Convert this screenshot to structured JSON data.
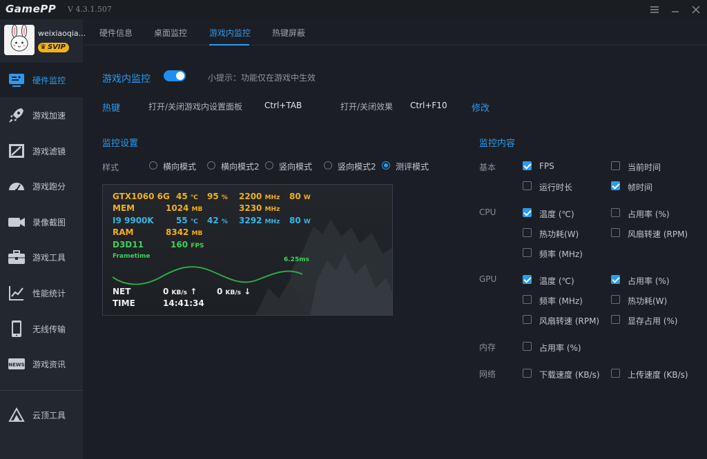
{
  "app": {
    "logo": "GamePP",
    "version": "V 4.3.1.507"
  },
  "user": {
    "name": "weixiaoqia...",
    "badge": "SVIP",
    "badge_crown": "♛"
  },
  "sidebar": {
    "items": [
      {
        "label": "硬件监控",
        "icon": "hardware-monitor-icon",
        "active": true
      },
      {
        "label": "游戏加速",
        "icon": "rocket-icon"
      },
      {
        "label": "游戏滤镜",
        "icon": "filter-icon"
      },
      {
        "label": "游戏跑分",
        "icon": "speedometer-icon"
      },
      {
        "label": "录像截图",
        "icon": "camera-icon"
      },
      {
        "label": "游戏工具",
        "icon": "toolbox-icon"
      },
      {
        "label": "性能统计",
        "icon": "chart-icon"
      },
      {
        "label": "无线传输",
        "icon": "tablet-icon"
      },
      {
        "label": "游戏资讯",
        "icon": "news-icon"
      }
    ],
    "cloud": {
      "label": "云顶工具",
      "icon": "cloud-tool-icon"
    }
  },
  "tabs": [
    {
      "label": "硬件信息"
    },
    {
      "label": "桌面监控"
    },
    {
      "label": "游戏内监控",
      "active": true
    },
    {
      "label": "热键屏蔽"
    }
  ],
  "main": {
    "title": "游戏内监控",
    "toggle_on": true,
    "hint": "小提示：功能仅在游戏中生效",
    "hotkey": {
      "label": "热键",
      "settings_label": "打开/关闭游戏内设置面板",
      "settings_key": "Ctrl+TAB",
      "effect_label": "打开/关闭效果",
      "effect_key": "Ctrl+F10",
      "modify": "修改"
    },
    "settings_title": "监控设置",
    "style_label": "样式",
    "styles": [
      {
        "label": "横向模式",
        "selected": false
      },
      {
        "label": "横向模式2",
        "selected": false
      },
      {
        "label": "竖向模式",
        "selected": false
      },
      {
        "label": "竖向模式2",
        "selected": false
      },
      {
        "label": "测评模式",
        "selected": true
      }
    ],
    "preview": {
      "gpu": {
        "name": "GTX1060 6G",
        "temp": "45",
        "temp_unit": "℃",
        "usage": "95",
        "usage_unit": "%",
        "clock": "2200",
        "clock_unit": "MHz",
        "power": "80",
        "power_unit": "W"
      },
      "mem": {
        "name": "MEM",
        "value": "1024",
        "value_unit": "MB",
        "clock": "3230",
        "clock_unit": "MHz"
      },
      "cpu": {
        "name": "I9 9900K",
        "temp": "55",
        "temp_unit": "℃",
        "usage": "42",
        "usage_unit": "%",
        "clock": "3292",
        "clock_unit": "MHz",
        "power": "80",
        "power_unit": "W"
      },
      "ram": {
        "name": "RAM",
        "value": "8342",
        "value_unit": "MB"
      },
      "d3d": {
        "name": "D3D11",
        "fps": "160",
        "fps_unit": "FPS"
      },
      "frametime": {
        "label": "Frametime",
        "value": "6.25ms"
      },
      "net": {
        "label": "NET",
        "up": "0",
        "up_unit": "KB/s",
        "up_arrow": "↑",
        "down": "0",
        "down_unit": "KB/s",
        "down_arrow": "↓"
      },
      "time": {
        "label": "TIME",
        "value": "14:41:34"
      }
    },
    "content_title": "监控内容",
    "groups": [
      {
        "name": "基本",
        "items": [
          {
            "label": "FPS",
            "checked": true
          },
          {
            "label": "当前时间",
            "checked": false
          },
          {
            "label": "运行时长",
            "checked": false
          },
          {
            "label": "帧时间",
            "checked": true
          }
        ]
      },
      {
        "name": "CPU",
        "items": [
          {
            "label": "温度 (℃)",
            "checked": true
          },
          {
            "label": "占用率 (%)",
            "checked": false
          },
          {
            "label": "热功耗(W)",
            "checked": false
          },
          {
            "label": "风扇转速 (RPM)",
            "checked": false
          },
          {
            "label": "频率 (MHz)",
            "checked": false
          }
        ]
      },
      {
        "name": "GPU",
        "items": [
          {
            "label": "温度 (℃)",
            "checked": true
          },
          {
            "label": "占用率 (%)",
            "checked": true
          },
          {
            "label": "频率 (MHz)",
            "checked": false
          },
          {
            "label": "热功耗(W)",
            "checked": false
          },
          {
            "label": "风扇转速 (RPM)",
            "checked": false
          },
          {
            "label": "显存占用 (%)",
            "checked": false
          }
        ]
      },
      {
        "name": "内存",
        "items": [
          {
            "label": "占用率 (%)",
            "checked": false
          }
        ]
      },
      {
        "name": "网络",
        "items": [
          {
            "label": "下载速度 (KB/s)",
            "checked": false
          },
          {
            "label": "上传速度 (KB/s)",
            "checked": false
          }
        ]
      }
    ]
  },
  "colors": {
    "accent": "#2a9bf2",
    "gpu_text": "#f2b01e",
    "cpu_text": "#39b6e8",
    "fps_text": "#3fd15a",
    "badge": "#f2b21c"
  }
}
